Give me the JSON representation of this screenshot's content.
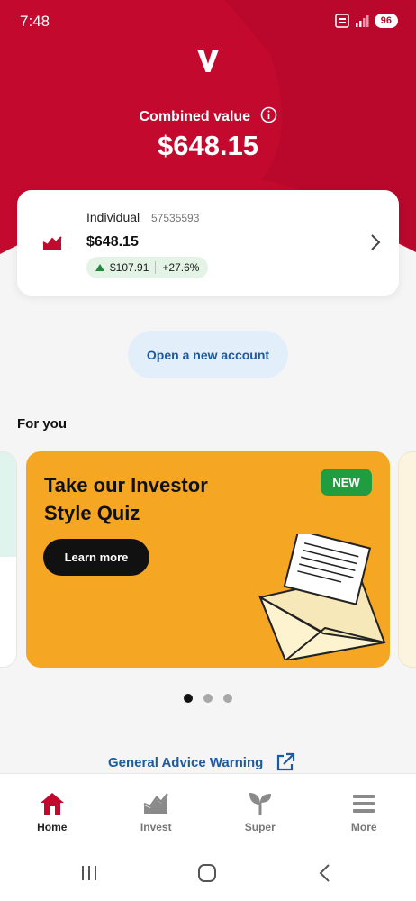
{
  "status_bar": {
    "time": "7:48",
    "battery": "96"
  },
  "brand": {
    "logo": "V",
    "color": "#c30a2e"
  },
  "summary": {
    "label": "Combined value",
    "value": "$648.15"
  },
  "account": {
    "name": "Individual",
    "number": "57535593",
    "value": "$648.15",
    "gain_amount": "$107.91",
    "gain_percent": "+27.6%",
    "icon": "chart-trend-icon"
  },
  "open_account_label": "Open a new account",
  "for_you": {
    "heading": "For you",
    "card": {
      "title": "Take our Investor Style Quiz",
      "badge": "NEW",
      "button": "Learn more",
      "color": "#f5a623"
    },
    "pagination": {
      "total": 3,
      "active": 1
    }
  },
  "advice_link": "General Advice Warning",
  "bottom_nav": [
    {
      "label": "Home",
      "icon": "home-icon",
      "active": true
    },
    {
      "label": "Invest",
      "icon": "invest-icon",
      "active": false
    },
    {
      "label": "Super",
      "icon": "sprout-icon",
      "active": false
    },
    {
      "label": "More",
      "icon": "menu-icon",
      "active": false
    }
  ]
}
